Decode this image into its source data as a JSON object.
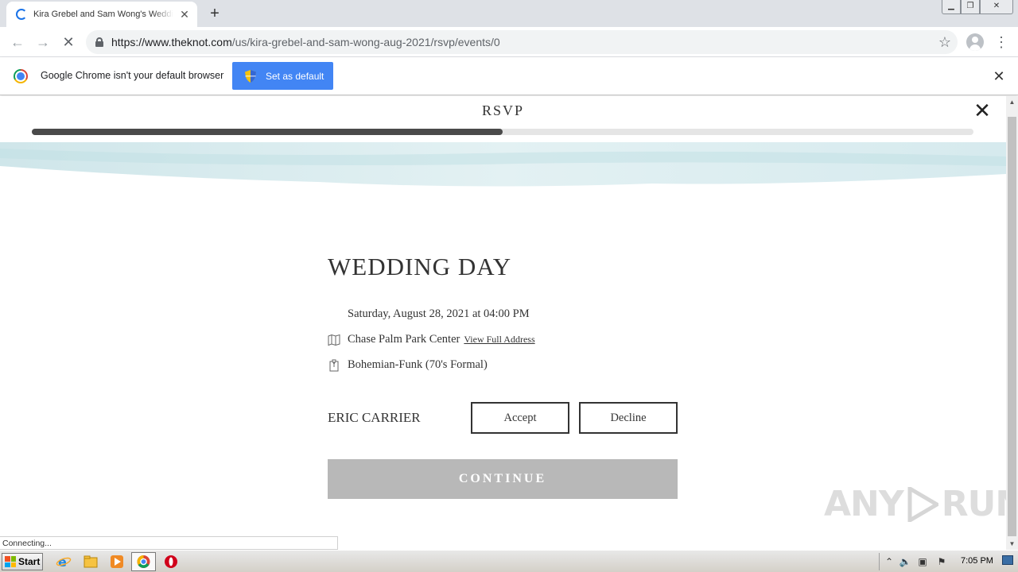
{
  "browser": {
    "tab_title": "Kira Grebel and Sam Wong's Wedding",
    "url_host": "https://www.theknot.com",
    "url_path": "/us/kira-grebel-and-sam-wong-aug-2021/rsvp/events/0",
    "status_text": "Connecting..."
  },
  "infobar": {
    "message": "Google Chrome isn't your default browser",
    "button_label": "Set as default"
  },
  "rsvp": {
    "title": "RSVP",
    "progress": 0.5,
    "event_title": "WEDDING DAY",
    "date_text": "Saturday, August 28, 2021 at 04:00 PM",
    "venue": "Chase Palm Park Center",
    "address_link": "View Full Address",
    "dress_code": "Bohemian-Funk (70's Formal)",
    "guest_name": "ERIC CARRIER",
    "accept_label": "Accept",
    "decline_label": "Decline",
    "continue_label": "CONTINUE"
  },
  "watermark": {
    "left": "ANY",
    "right": "RUN"
  },
  "taskbar": {
    "start_label": "Start",
    "clock": "7:05 PM"
  },
  "colors": {
    "accent": "#4285f4",
    "progress_fill": "#4a4a4a",
    "continue_bg": "#b8b8b8",
    "watercolor": "#cfe6ea"
  }
}
